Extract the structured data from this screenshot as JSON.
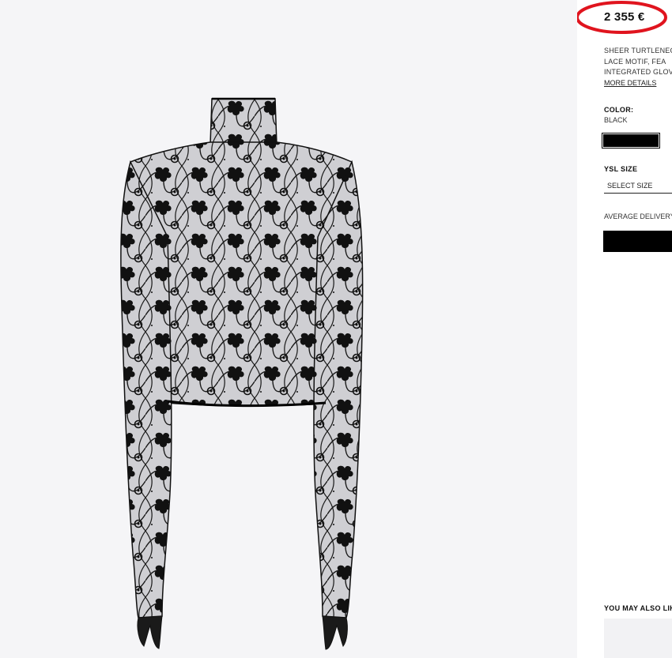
{
  "product": {
    "price": "2 355 €",
    "description_lines": [
      "SHEER TURTLENECK",
      "LACE MOTIF, FEA",
      "INTEGRATED GLOVES"
    ],
    "more_details": "MORE DETAILS",
    "color_label": "COLOR:",
    "color_value": "BLACK",
    "size_label": "YSL SIZE",
    "size_placeholder": "SELECT SIZE",
    "delivery_text": "AVERAGE DELIVERY",
    "you_may_also": "YOU MAY ALSO LIKE"
  },
  "colors": {
    "background": "#f5f5f7",
    "panel": "#ffffff",
    "swatch": "#000000",
    "highlight_circle": "#e0141e",
    "lace": "#101010"
  },
  "icons": {
    "product_image": "lace-turtleneck-top-with-gloves"
  }
}
